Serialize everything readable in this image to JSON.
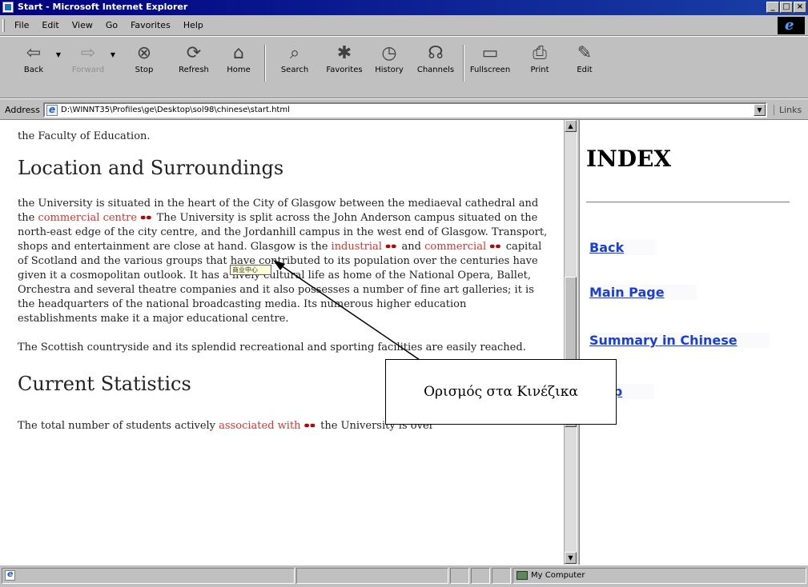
{
  "window": {
    "title": "Start - Microsoft Internet Explorer",
    "buttons": [
      "_",
      "□",
      "×"
    ]
  },
  "menu": {
    "items": [
      "File",
      "Edit",
      "View",
      "Go",
      "Favorites",
      "Help"
    ]
  },
  "toolbar": {
    "buttons": [
      {
        "label": "Back",
        "icon": "back-arrow-icon",
        "glyph": "⇦",
        "disabled": false
      },
      {
        "label": "Forward",
        "icon": "forward-arrow-icon",
        "glyph": "⇨",
        "disabled": true
      },
      {
        "label": "Stop",
        "icon": "stop-icon",
        "glyph": "⊗",
        "disabled": false
      },
      {
        "label": "Refresh",
        "icon": "refresh-icon",
        "glyph": "⟳",
        "disabled": false
      },
      {
        "label": "Home",
        "icon": "home-icon",
        "glyph": "⌂",
        "disabled": false
      },
      {
        "label": "Search",
        "icon": "search-icon",
        "glyph": "⌕",
        "disabled": false
      },
      {
        "label": "Favorites",
        "icon": "favorites-icon",
        "glyph": "✱",
        "disabled": false
      },
      {
        "label": "History",
        "icon": "history-icon",
        "glyph": "◷",
        "disabled": false
      },
      {
        "label": "Channels",
        "icon": "channels-icon",
        "glyph": "☊",
        "disabled": false
      },
      {
        "label": "Fullscreen",
        "icon": "fullscreen-icon",
        "glyph": "▭",
        "disabled": false
      },
      {
        "label": "Print",
        "icon": "print-icon",
        "glyph": "⎙",
        "disabled": false
      },
      {
        "label": "Edit",
        "icon": "edit-icon",
        "glyph": "✎",
        "disabled": false
      }
    ]
  },
  "address": {
    "label": "Address",
    "value": "D:\\WINNT35\\Profiles\\ge\\Desktop\\sol98\\chinese\\start.html",
    "links_label": "Links"
  },
  "article": {
    "intro_fragment": "the Faculty of Education.",
    "heading1": "Location and Surroundings",
    "para1": [
      {
        "t": "the University is situated in the heart of the City of Glasgow between the mediaeval cathedral and the "
      },
      {
        "t": "commercial centre",
        "hl": true
      },
      {
        "t": "  The University is split across the John Anderson campus situated on the north-east edge of the city centre, and the Jordanhill campus in the west end of Glasgow. Transport, shops and entertainment are close at hand. Glasgow is the "
      },
      {
        "t": "industrial",
        "hl": true
      },
      {
        "t": " and "
      },
      {
        "t": "commercial",
        "hl": true
      },
      {
        "t": " capital of Scotland and the various groups that have contributed to its population over the centuries have given it a cosmopolitan outlook. It has a lively cultural life as home of the National Opera, Ballet, Orchestra and several theatre companies and it also possesses a number of fine art galleries; it is the headquarters of the national broadcasting media. Its numerous higher education establishments make it a major educational centre."
      }
    ],
    "para2": "The Scottish countryside and its splendid recreational and sporting facilities are easily reached.",
    "heading2": "Current Statistics",
    "para3_prefix": "The total number of students actively ",
    "para3_hl": "associated with",
    "para3_suffix": " the University is over"
  },
  "index": {
    "title": "INDEX",
    "links": [
      "Back",
      "Main Page",
      "Summary in Chinese",
      "Help"
    ]
  },
  "popup": {
    "mini_text": "商业中心"
  },
  "callout": {
    "text": "Ορισμός στα Κινέζικα"
  },
  "status": {
    "zone": "My Computer"
  },
  "colors": {
    "highlight": "#e0322d",
    "link": "#1a3fd8",
    "titlebar": "#000080"
  }
}
